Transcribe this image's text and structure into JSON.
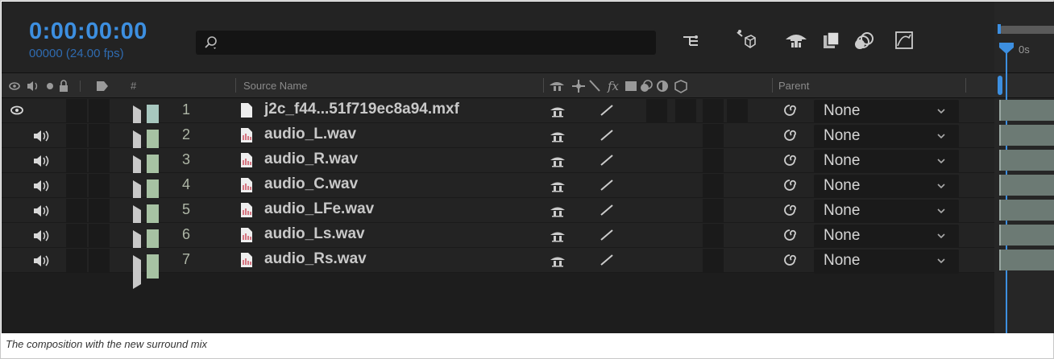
{
  "timecode": "0:00:00:00",
  "frames_fps": "00000 (24.00 fps)",
  "search": {
    "placeholder": ""
  },
  "columns": {
    "hash": "#",
    "source_name": "Source Name",
    "parent": "Parent"
  },
  "ruler": {
    "label": "0s"
  },
  "layers": [
    {
      "num": "1",
      "name": "j2c_f44...51f719ec8a94.mxf",
      "parent": "None",
      "type": "video",
      "swatch": "#a7c7be"
    },
    {
      "num": "2",
      "name": "audio_L.wav",
      "parent": "None",
      "type": "audio",
      "swatch": "#a7c2a3"
    },
    {
      "num": "3",
      "name": "audio_R.wav",
      "parent": "None",
      "type": "audio",
      "swatch": "#a7c2a3"
    },
    {
      "num": "4",
      "name": "audio_C.wav",
      "parent": "None",
      "type": "audio",
      "swatch": "#a7c2a3"
    },
    {
      "num": "5",
      "name": "audio_LFe.wav",
      "parent": "None",
      "type": "audio",
      "swatch": "#a7c2a3"
    },
    {
      "num": "6",
      "name": "audio_Ls.wav",
      "parent": "None",
      "type": "audio",
      "swatch": "#a7c2a3"
    },
    {
      "num": "7",
      "name": "audio_Rs.wav",
      "parent": "None",
      "type": "audio",
      "swatch": "#a7c2a3"
    }
  ],
  "caption": "The composition with the new surround mix",
  "colors": {
    "accent": "#3d8fe0",
    "panel_bg": "#1d1d1d"
  }
}
